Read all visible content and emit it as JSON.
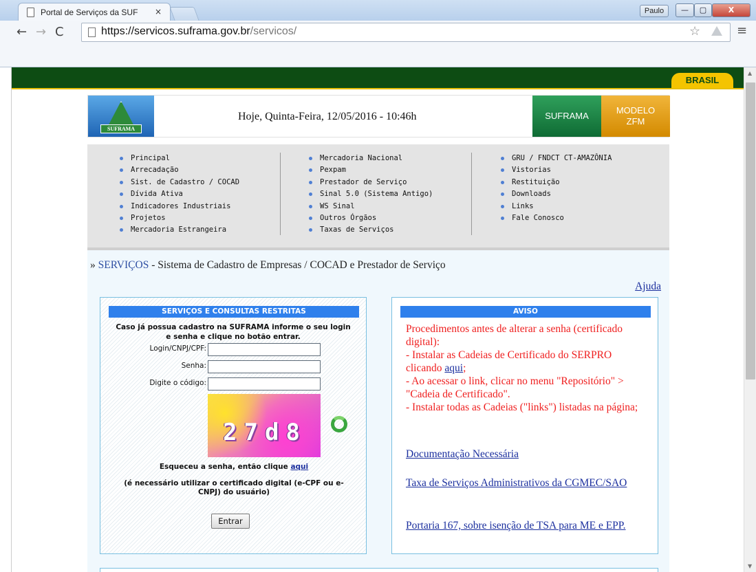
{
  "browser": {
    "tab_title": "Portal de Serviços da SUF",
    "tab_close": "×",
    "profile": "Paulo",
    "url_host": "https://servicos.suframa.gov.br",
    "url_path": "/servicos/",
    "back": "←",
    "forward": "→",
    "reload": "C",
    "star": "☆",
    "menu": "≡",
    "min": "—",
    "max": "▢",
    "close": "X"
  },
  "govbar": {
    "brasil": "BRASIL"
  },
  "header": {
    "logo_text": "SUFRAMA",
    "date": "Hoje, Quinta-Feira, 12/05/2016 - 10:46h",
    "suframa": "SUFRAMA",
    "zfm_line1": "MODELO",
    "zfm_line2": "ZFM"
  },
  "menu": {
    "col1": [
      "Principal",
      "Arrecadação",
      "Sist. de Cadastro / COCAD",
      "Dívida Ativa",
      "Indicadores Industriais",
      "Projetos",
      "Mercadoria Estrangeira"
    ],
    "col2": [
      "Mercadoria Nacional",
      "Pexpam",
      "Prestador de Serviço",
      "Sinal 5.0 (Sistema Antigo)",
      "WS Sinal",
      "Outros Órgãos",
      "Taxas de Serviços"
    ],
    "col3": [
      "GRU / FNDCT CT-AMAZÔNIA",
      "Vistorias",
      "Restituição",
      "Downloads",
      "Links",
      "Fale Conosco"
    ]
  },
  "breadcrumb": {
    "prefix": "» ",
    "link": "SERVIÇOS",
    "rest": " - Sistema de Cadastro de Empresas / COCAD e Prestador de Serviço"
  },
  "help": "Ajuda",
  "login": {
    "title": "SERVIÇOS E CONSULTAS RESTRITAS",
    "intro": "Caso já possua cadastro na SUFRAMA informe o seu login e senha e clique no botão entrar.",
    "login_label": "Login/CNPJ/CPF:",
    "senha_label": "Senha:",
    "codigo_label": "Digite o código:",
    "captcha": "27d8",
    "forgot_text": "Esqueceu a senha, então clique ",
    "forgot_link": "aqui",
    "cert_note": "(é necessário utilizar o certificado digital (e-CPF ou e-CNPJ) do usuário)",
    "enter": "Entrar"
  },
  "notice": {
    "title": "AVISO",
    "p1": "Procedimentos antes de alterar a senha (certificado digital):",
    "p2": "- Instalar as Cadeias de Certificado do SERPRO clicando ",
    "p2_link": "aqui",
    "p2_end": ";",
    "p3": "- Ao acessar o link, clicar no menu \"Repositório\" > \"Cadeia de Certificado\".",
    "p4": "- Instalar todas as Cadeias (\"links\") listadas na página;",
    "link1": "Documentação Necessária ",
    "link2": "Taxa de Serviços Administrativos da CGMEC/SAO ",
    "link3": "Portaria 167, sobre isenção de TSA para ME e EPP."
  }
}
